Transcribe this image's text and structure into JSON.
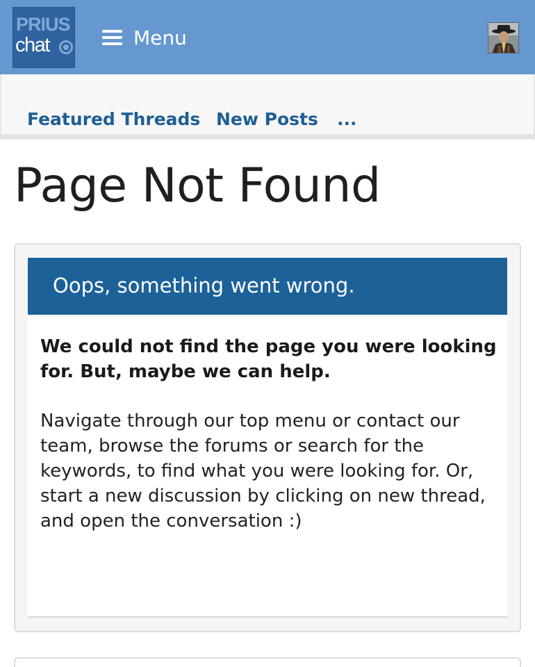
{
  "header": {
    "logo": {
      "line1": "PRIUS",
      "line2": "chat"
    },
    "menu_label": "Menu",
    "avatar_icon": "user-avatar-icon"
  },
  "nav": {
    "items": [
      {
        "label": "Featured Threads"
      },
      {
        "label": "New Posts"
      },
      {
        "label": "..."
      }
    ]
  },
  "page": {
    "title": "Page Not Found"
  },
  "error_block": {
    "header": "Oops, something went wrong.",
    "lead": "We could not find the page you were looking for. But, maybe we can help.",
    "body": "Navigate through our top menu or contact our team, browse the forums or search for the keywords, to find what you were looking for. Or, start a new discussion by clicking on new thread, and open the conversation :)"
  },
  "colors": {
    "header_bg": "#6598cf",
    "accent": "#1d6199",
    "nav_text": "#1f5e94"
  }
}
